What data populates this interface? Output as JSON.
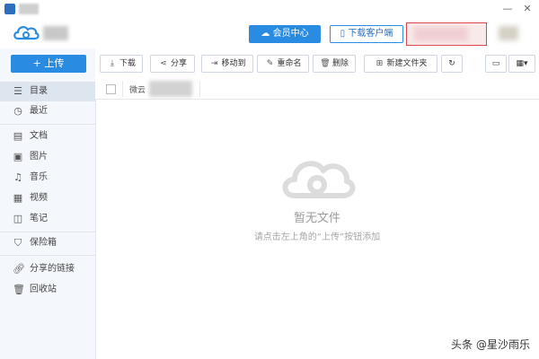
{
  "window": {
    "minimize_icon": "minimize-icon",
    "close_icon": "close-icon"
  },
  "header": {
    "member_center_label": "会员中心",
    "download_client_label": "下载客户端"
  },
  "sidebar": {
    "upload_label": "+ 上传",
    "items": [
      {
        "label": "目录",
        "icon": "list-icon"
      },
      {
        "label": "最近",
        "icon": "clock-icon"
      },
      {
        "label": "文档",
        "icon": "document-icon"
      },
      {
        "label": "图片",
        "icon": "image-icon"
      },
      {
        "label": "音乐",
        "icon": "music-icon"
      },
      {
        "label": "视频",
        "icon": "video-icon"
      },
      {
        "label": "笔记",
        "icon": "note-icon"
      },
      {
        "label": "保险箱",
        "icon": "shield-icon"
      },
      {
        "label": "分享的链接",
        "icon": "link-icon"
      },
      {
        "label": "回收站",
        "icon": "trash-icon"
      }
    ]
  },
  "toolbar": {
    "download": "下载",
    "share": "分享",
    "move_to": "移动到",
    "rename": "重命名",
    "delete": "删除",
    "new_folder": "新建文件夹"
  },
  "list": {
    "name_col_prefix": "微云"
  },
  "empty": {
    "title": "暂无文件",
    "hint": "请点击左上角的“上传”按钮添加"
  },
  "watermark": "头条 @星沙雨乐",
  "colors": {
    "accent": "#2a8be3",
    "sidebar_bg": "#f4f7fb",
    "active_bg": "#dde5ef"
  }
}
